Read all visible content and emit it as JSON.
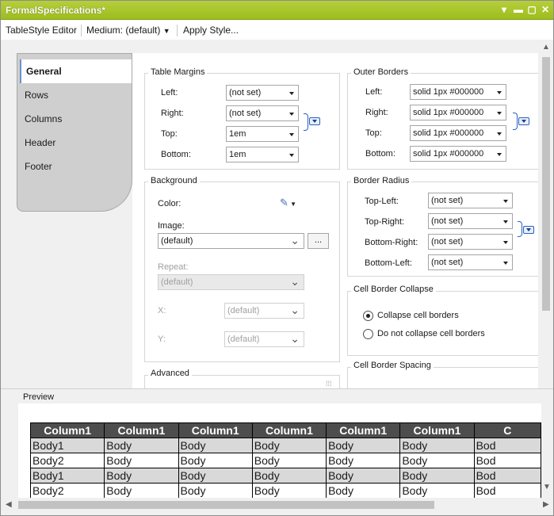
{
  "window": {
    "title": "FormalSpecifications*"
  },
  "toolbar": {
    "editor_label": "TableStyle Editor",
    "style_select": "Medium: (default)",
    "apply_label": "Apply Style..."
  },
  "tabs": [
    {
      "label": "General",
      "active": true
    },
    {
      "label": "Rows"
    },
    {
      "label": "Columns"
    },
    {
      "label": "Header"
    },
    {
      "label": "Footer"
    }
  ],
  "table_margins": {
    "title": "Table Margins",
    "rows": [
      {
        "label": "Left:",
        "value": "(not set)"
      },
      {
        "label": "Right:",
        "value": "(not set)"
      },
      {
        "label": "Top:",
        "value": "1em"
      },
      {
        "label": "Bottom:",
        "value": "1em"
      }
    ]
  },
  "outer_borders": {
    "title": "Outer Borders",
    "rows": [
      {
        "label": "Left:",
        "value": "solid 1px #000000"
      },
      {
        "label": "Right:",
        "value": "solid 1px #000000"
      },
      {
        "label": "Top:",
        "value": "solid 1px #000000"
      },
      {
        "label": "Bottom:",
        "value": "solid 1px #000000"
      }
    ]
  },
  "background": {
    "title": "Background",
    "color_label": "Color:",
    "image_label": "Image:",
    "image_value": "(default)",
    "browse_label": "...",
    "repeat_label": "Repeat:",
    "repeat_value": "(default)",
    "x_label": "X:",
    "x_value": "(default)",
    "y_label": "Y:",
    "y_value": "(default)"
  },
  "border_radius": {
    "title": "Border Radius",
    "rows": [
      {
        "label": "Top-Left:",
        "value": "(not set)"
      },
      {
        "label": "Top-Right:",
        "value": "(not set)"
      },
      {
        "label": "Bottom-Right:",
        "value": "(not set)"
      },
      {
        "label": "Bottom-Left:",
        "value": "(not set)"
      }
    ]
  },
  "cell_border_collapse": {
    "title": "Cell Border Collapse",
    "options": [
      {
        "label": "Collapse cell borders",
        "checked": true
      },
      {
        "label": "Do not collapse cell borders",
        "checked": false
      }
    ]
  },
  "advanced": {
    "title": "Advanced"
  },
  "cell_border_spacing": {
    "title": "Cell Border Spacing"
  },
  "preview": {
    "title": "Preview",
    "headers": [
      "Column1",
      "Column1",
      "Column1",
      "Column1",
      "Column1",
      "Column1",
      "C"
    ],
    "rows": [
      [
        "Body1",
        "Body",
        "Body",
        "Body",
        "Body",
        "Body",
        "Bod"
      ],
      [
        "Body2",
        "Body",
        "Body",
        "Body",
        "Body",
        "Body",
        "Bod"
      ],
      [
        "Body1",
        "Body",
        "Body",
        "Body",
        "Body",
        "Body",
        "Bod"
      ],
      [
        "Body2",
        "Body",
        "Body",
        "Body",
        "Body",
        "Body",
        "Bod"
      ]
    ]
  },
  "colors": {
    "titlebar": "#a4c21f",
    "header_cell": "#4d4d4d",
    "odd_row": "#d9d9d9",
    "accent": "#2b5fbf"
  }
}
